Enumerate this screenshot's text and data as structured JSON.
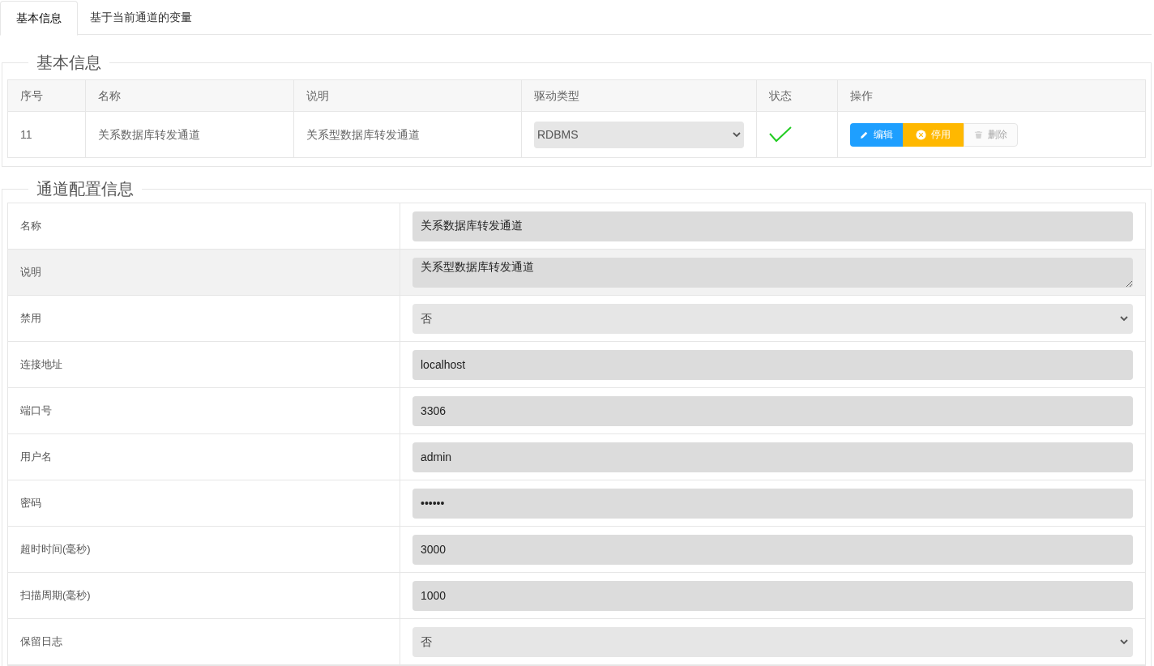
{
  "tabs": [
    {
      "label": "基本信息",
      "selected": true
    },
    {
      "label": "基于当前通道的变量",
      "selected": false
    }
  ],
  "basic_info": {
    "legend": "基本信息",
    "columns": [
      "序号",
      "名称",
      "说明",
      "驱动类型",
      "状态",
      "操作"
    ],
    "row": {
      "index": "11",
      "name": "关系数据库转发通道",
      "description": "关系型数据库转发通道",
      "driver": "RDBMS",
      "enabled": true,
      "actions": [
        {
          "kind": "edit",
          "label": "编辑",
          "disabled": false
        },
        {
          "kind": "stop",
          "label": "停用",
          "disabled": false
        },
        {
          "kind": "delete",
          "label": "删除",
          "disabled": true
        }
      ]
    }
  },
  "channel_config": {
    "legend": "通道配置信息",
    "rows": [
      {
        "label": "名称",
        "kind": "input",
        "value": "关系数据库转发通道",
        "highlighted": false
      },
      {
        "label": "说明",
        "kind": "textarea",
        "value": "关系型数据库转发通道",
        "highlighted": true
      },
      {
        "label": "禁用",
        "kind": "select",
        "value": "否",
        "highlighted": false
      },
      {
        "label": "连接地址",
        "kind": "input",
        "value": "localhost",
        "highlighted": false
      },
      {
        "label": "端口号",
        "kind": "input",
        "value": "3306",
        "highlighted": false
      },
      {
        "label": "用户名",
        "kind": "input",
        "value": "admin",
        "highlighted": false
      },
      {
        "label": "密码",
        "kind": "input",
        "value": "••••••",
        "highlighted": false
      },
      {
        "label": "超时时间(毫秒)",
        "kind": "input",
        "value": "3000",
        "highlighted": false
      },
      {
        "label": "扫描周期(毫秒)",
        "kind": "input",
        "value": "1000",
        "highlighted": false
      },
      {
        "label": "保留日志",
        "kind": "select",
        "value": "否",
        "highlighted": false
      }
    ]
  }
}
